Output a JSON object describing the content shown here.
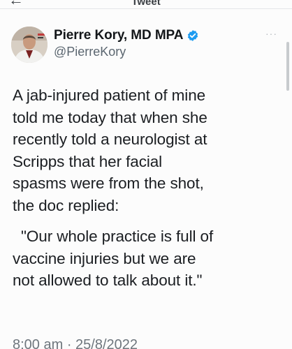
{
  "header": {
    "title": "Tweet",
    "back_icon": "back-arrow-icon"
  },
  "author": {
    "display_name": "Pierre Kory, MD MPA",
    "handle": "@PierreKory",
    "verified": true,
    "verified_color": "#1d9bf0"
  },
  "tweet": {
    "lines": [
      "A jab-injured patient of mine",
      "told me today that when she",
      "recently told a neurologist at",
      "Scripps that her facial",
      "spasms were from the shot,",
      "the doc replied:"
    ],
    "quote_lines": [
      "\"Our whole practice is full of",
      "vaccine injuries but we are",
      "not allowed to talk about it.\""
    ],
    "timestamp": "8:00 am · 25/8/2022"
  },
  "more_icon": "more-options-icon"
}
